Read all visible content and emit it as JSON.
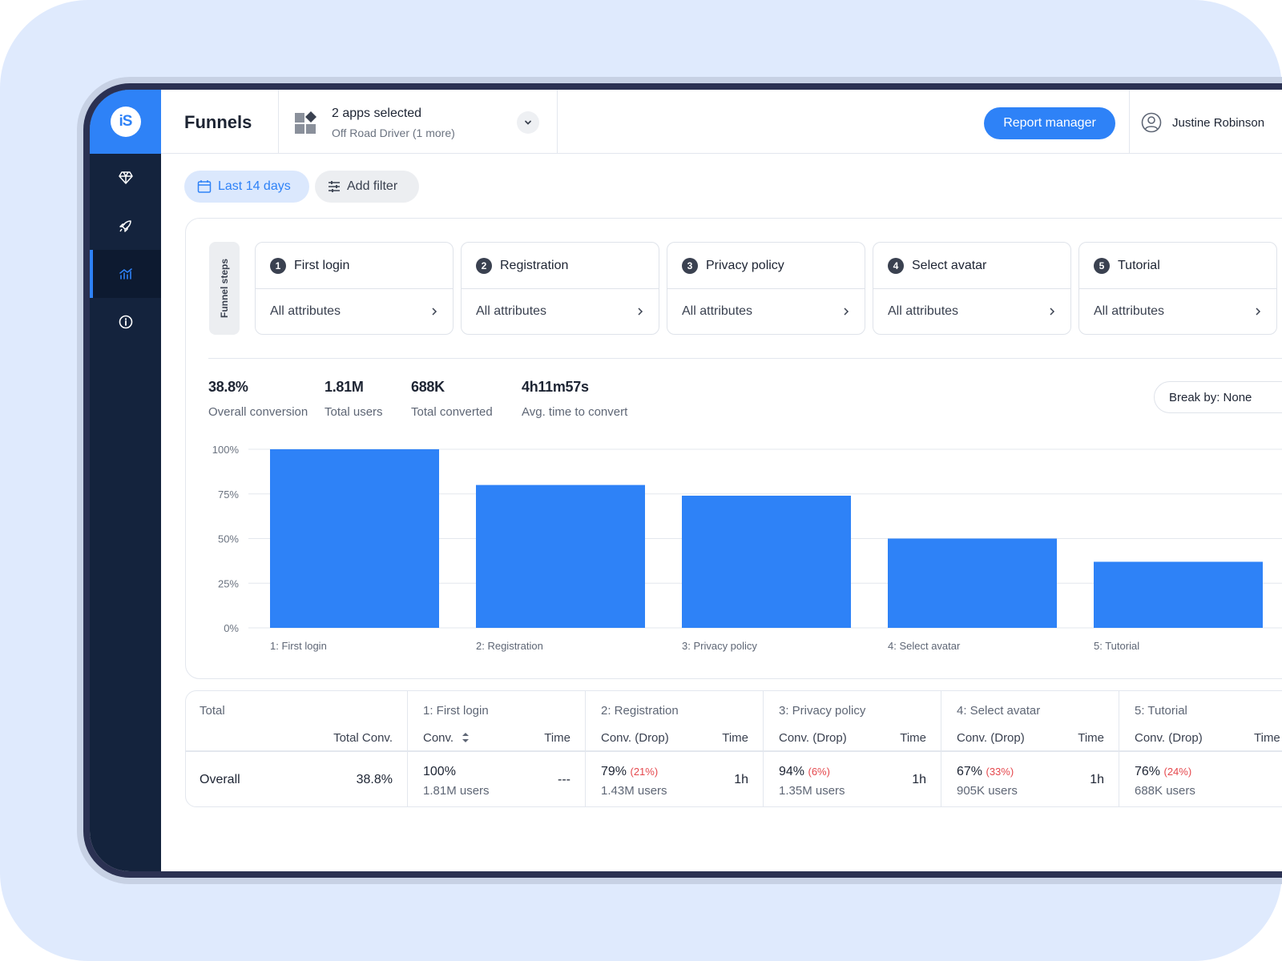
{
  "brand": {
    "logo_text": "iS",
    "accent": "#2e82f7",
    "sidebar_bg": "#14233d"
  },
  "sidebar": {
    "items": [
      {
        "icon": "diamond-icon",
        "active": false
      },
      {
        "icon": "rocket-icon",
        "active": false
      },
      {
        "icon": "funnel-chart-icon",
        "active": true
      },
      {
        "icon": "info-icon",
        "active": false
      }
    ]
  },
  "header": {
    "title": "Funnels",
    "apps_title": "2 apps selected",
    "apps_sub": "Off Road Driver (1 more)",
    "report_button": "Report manager",
    "user_name": "Justine Robinson"
  },
  "filters": {
    "date": "Last 14 days",
    "add_filter": "Add filter"
  },
  "funnel": {
    "steps_label": "Funnel steps",
    "steps": [
      {
        "num": "1",
        "name": "First login",
        "attr": "All attributes"
      },
      {
        "num": "2",
        "name": "Registration",
        "attr": "All attributes"
      },
      {
        "num": "3",
        "name": "Privacy policy",
        "attr": "All attributes"
      },
      {
        "num": "4",
        "name": "Select avatar",
        "attr": "All attributes"
      },
      {
        "num": "5",
        "name": "Tutorial",
        "attr": "All attributes"
      }
    ]
  },
  "stats": [
    {
      "value": "38.8%",
      "label": "Overall conversion"
    },
    {
      "value": "1.81M",
      "label": "Total users"
    },
    {
      "value": "688K",
      "label": "Total converted"
    },
    {
      "value": "4h11m57s",
      "label": "Avg. time to convert"
    }
  ],
  "break_by": "Break by: None",
  "chart_data": {
    "type": "bar",
    "categories": [
      "1: First login",
      "2: Registration",
      "3: Privacy policy",
      "4: Select avatar",
      "5: Tutorial"
    ],
    "values": [
      100,
      80,
      74,
      50,
      37
    ],
    "yticks": [
      "100%",
      "75%",
      "50%",
      "25%",
      "0%"
    ],
    "ylim": [
      0,
      100
    ],
    "color": "#2e82f7",
    "grid": true
  },
  "table": {
    "total_group": "Total",
    "total_conv_header": "Total Conv.",
    "row_label": "Overall",
    "row_total": "38.8%",
    "columns": [
      {
        "group": "1: First login",
        "conv_header": "Conv.",
        "time_header": "Time",
        "conv": "100%",
        "drop": "",
        "users": "1.81M users",
        "time": "---"
      },
      {
        "group": "2: Registration",
        "conv_header": "Conv. (Drop)",
        "time_header": "Time",
        "conv": "79%",
        "drop": "(21%)",
        "users": "1.43M users",
        "time": "1h"
      },
      {
        "group": "3: Privacy policy",
        "conv_header": "Conv. (Drop)",
        "time_header": "Time",
        "conv": "94%",
        "drop": "(6%)",
        "users": "1.35M users",
        "time": "1h"
      },
      {
        "group": "4: Select avatar",
        "conv_header": "Conv. (Drop)",
        "time_header": "Time",
        "conv": "67%",
        "drop": "(33%)",
        "users": "905K users",
        "time": "1h"
      },
      {
        "group": "5: Tutorial",
        "conv_header": "Conv. (Drop)",
        "time_header": "Time",
        "conv": "76%",
        "drop": "(24%)",
        "users": "688K users",
        "time": ""
      }
    ]
  }
}
